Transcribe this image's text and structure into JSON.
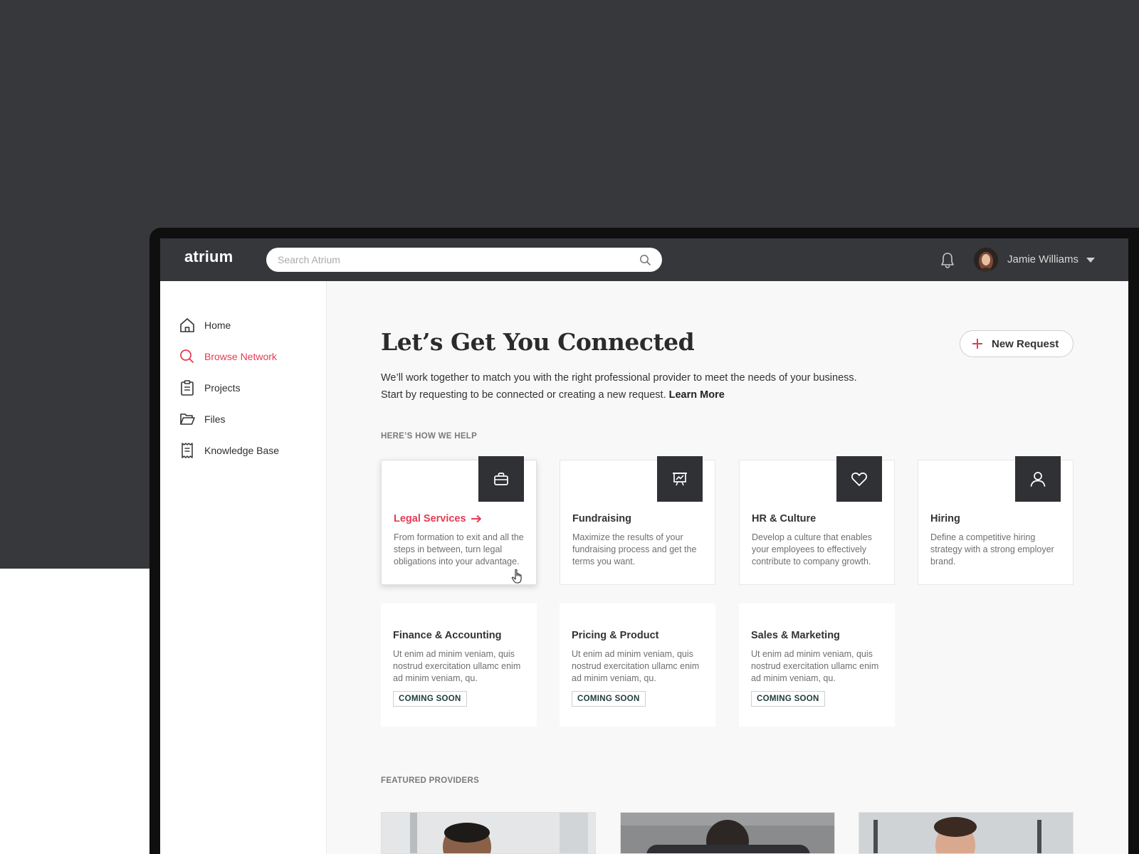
{
  "app": {
    "logo": "atrium"
  },
  "search": {
    "placeholder": "Search Atrium"
  },
  "user": {
    "name": "Jamie Williams"
  },
  "sidebar": {
    "items": [
      {
        "label": "Home",
        "icon": "home-icon",
        "active": false
      },
      {
        "label": "Browse Network",
        "icon": "search-icon",
        "active": true
      },
      {
        "label": "Projects",
        "icon": "clipboard-icon",
        "active": false
      },
      {
        "label": "Files",
        "icon": "folder-open-icon",
        "active": false
      },
      {
        "label": "Knowledge Base",
        "icon": "receipt-icon",
        "active": false
      }
    ]
  },
  "main": {
    "title": "Let’s Get You Connected",
    "new_request_label": "New Request",
    "intro_line1": "We’ll work together to match you with the right professional provider to meet the needs of your business.",
    "intro_line2": "Start by requesting to be connected or creating a new request.",
    "learn_more": "Learn More",
    "how_we_help_label": "HERE’S HOW WE HELP",
    "featured_label": "FEATURED PROVIDERS",
    "services": [
      {
        "title": "Legal Services",
        "desc": "From formation to exit and all the steps in between, turn legal obligations into your advantage.",
        "icon": "briefcase-icon"
      },
      {
        "title": "Fundraising",
        "desc": "Maximize the results of your fundraising process and get the terms you want.",
        "icon": "presentation-chart-icon"
      },
      {
        "title": "HR & Culture",
        "desc": "Develop a culture that enables your employees to effectively contribute to company growth.",
        "icon": "heart-icon"
      },
      {
        "title": "Hiring",
        "desc": "Define a competitive hiring strategy with a strong employer brand.",
        "icon": "user-icon"
      }
    ],
    "coming_soon": [
      {
        "title": "Finance & Accounting",
        "desc": "Ut enim ad minim veniam, quis nostrud exercitation ullamc enim ad minim veniam, qu.",
        "badge": "COMING SOON"
      },
      {
        "title": "Pricing & Product",
        "desc": "Ut enim ad minim veniam, quis nostrud exercitation ullamc enim ad minim veniam, qu.",
        "badge": "COMING SOON"
      },
      {
        "title": "Sales & Marketing",
        "desc": "Ut enim ad minim veniam, quis nostrud exercitation ullamc enim ad minim veniam, qu.",
        "badge": "COMING SOON"
      }
    ]
  },
  "colors": {
    "accent": "#e53b55",
    "topbar": "#36373a",
    "backdrop": "#37383b",
    "icon_tile": "#303134"
  }
}
